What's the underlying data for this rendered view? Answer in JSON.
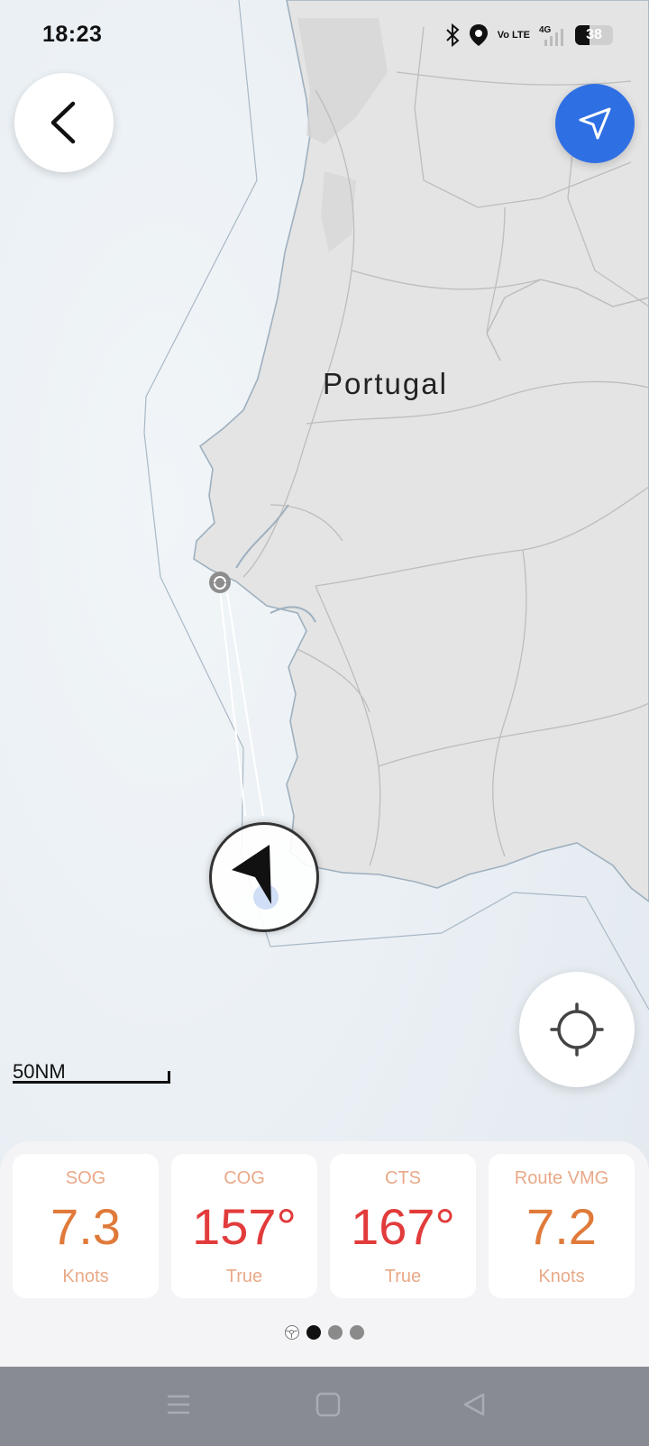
{
  "status_bar": {
    "time": "18:23",
    "volte": "Vo LTE",
    "network": "4G",
    "battery": "38",
    "icons": [
      "bluetooth-icon",
      "location-icon",
      "volte-icon",
      "signal-icon",
      "battery-icon"
    ]
  },
  "map": {
    "country_label": "Portugal",
    "scale_label": "50NM",
    "colors": {
      "sea": "#e9eef3",
      "land": "#e4e4e4",
      "coast": "#9eb0bf",
      "route": "#b9cbd9"
    }
  },
  "buttons": {
    "back_icon": "chevron-left-icon",
    "navigate_icon": "navigation-arrow-icon",
    "locate_icon": "crosshair-icon"
  },
  "metrics": [
    {
      "label": "SOG",
      "value": "7.3",
      "unit": "Knots",
      "color": "#e07a3a"
    },
    {
      "label": "COG",
      "value": "157°",
      "unit": "True",
      "color": "#e23b3b"
    },
    {
      "label": "CTS",
      "value": "167°",
      "unit": "True",
      "color": "#e23b3b"
    },
    {
      "label": "Route VMG",
      "value": "7.2",
      "unit": "Knots",
      "color": "#e07a3a"
    }
  ],
  "pagination": {
    "pages": 4,
    "active_index": 1
  },
  "system_nav": {
    "icons": [
      "menu-icon",
      "home-icon",
      "back-triangle-icon"
    ]
  }
}
